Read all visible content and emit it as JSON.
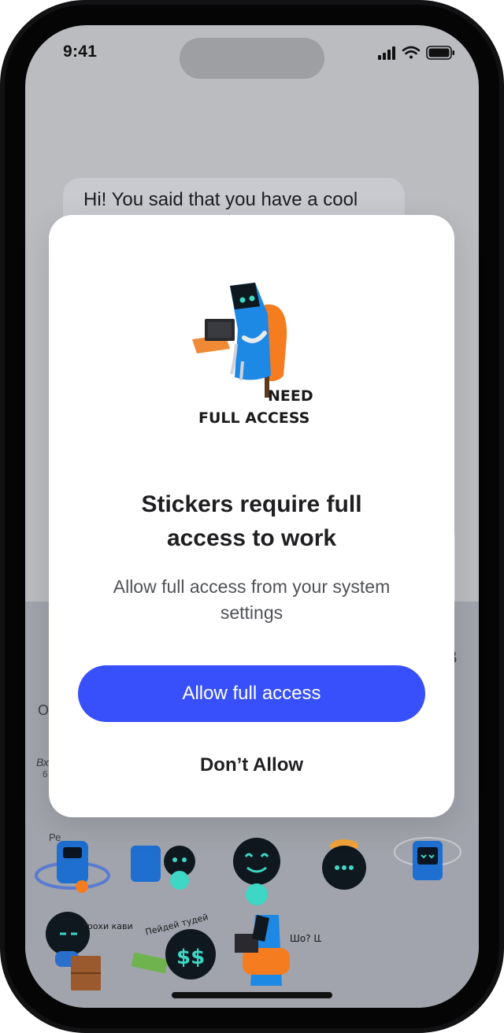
{
  "status_bar": {
    "time": "9:41",
    "icons": [
      "cellular-signal-icon",
      "wifi-icon",
      "battery-icon"
    ]
  },
  "chat": {
    "message": "Hi! You said that you have a cool"
  },
  "modal": {
    "sticker_caption_top": "NEED",
    "sticker_caption_bottom": "FULL ACCESS",
    "title_line1": "Stickers require full",
    "title_line2": "access to work",
    "subtitle_line1": "Allow full access from your system",
    "subtitle_line2": "settings",
    "allow_label": "Allow full access",
    "deny_label": "Don’t Allow"
  },
  "sticker_panel": {
    "fragments": [
      "O",
      "B",
      "Вх",
      "б",
      "Ре"
    ],
    "sticker_texts": {
      "coffee": "Трохи кави?",
      "money": "Пейдей тудей",
      "what": "Шо? Шо?"
    }
  },
  "colors": {
    "accent": "#3750FB",
    "dim_background": "#BBBCC0",
    "sticker_panel": "#A1A4AC",
    "robot_blue": "#1E88E5",
    "robot_teal": "#3ED6C4",
    "chair_orange": "#F57C1F"
  }
}
